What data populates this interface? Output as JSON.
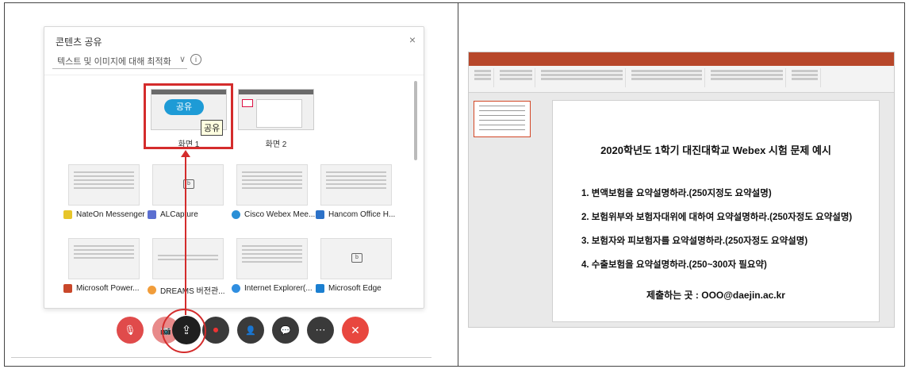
{
  "share_dialog": {
    "title": "콘텐츠 공유",
    "close": "×",
    "optimize_option": "텍스트 및 이미지에 대해 최적화",
    "info": "i",
    "screens": [
      {
        "label": "화면 1",
        "share_button": "공유",
        "tooltip": "공유"
      },
      {
        "label": "화면 2"
      }
    ],
    "apps": [
      {
        "label": "NateOn Messenger",
        "icon": "nateon-icon",
        "color": "#e7c52a"
      },
      {
        "label": "ALCapture",
        "icon": "alcapture-icon",
        "color": "#5b6fd1"
      },
      {
        "label": "Cisco Webex Mee...",
        "icon": "webex-icon",
        "color": "#2a8fd6"
      },
      {
        "label": "Hancom Office H...",
        "icon": "hancom-icon",
        "color": "#2d72c8"
      },
      {
        "label": "Microsoft Power...",
        "icon": "powerpoint-icon",
        "color": "#c9472a"
      },
      {
        "label": "DREAMS 버전관...",
        "icon": "dreams-icon",
        "color": "#f19d3b"
      },
      {
        "label": "Internet Explorer(...",
        "icon": "ie-icon",
        "color": "#2f8ee0"
      },
      {
        "label": "Microsoft Edge",
        "icon": "edge-icon",
        "color": "#1b7fd0"
      }
    ]
  },
  "toolbar": [
    {
      "name": "mute-button",
      "icon": "mic-off-icon",
      "color": "#e04b4b",
      "glyph": "🎙"
    },
    {
      "name": "video-button",
      "icon": "camera-off-icon",
      "color": "#e88a8a",
      "glyph": "📷"
    },
    {
      "name": "share-content-button",
      "icon": "share-icon",
      "color": "#1f1f1f",
      "glyph": "⇪"
    },
    {
      "name": "record-button",
      "icon": "record-icon",
      "color": "#3a3a3a",
      "glyph": "⏺"
    },
    {
      "name": "participants-button",
      "icon": "participants-icon",
      "color": "#3a3a3a",
      "glyph": "👤"
    },
    {
      "name": "chat-button",
      "icon": "chat-icon",
      "color": "#3a3a3a",
      "glyph": "💬"
    },
    {
      "name": "more-button",
      "icon": "more-icon",
      "color": "#3a3a3a",
      "glyph": "⋯"
    },
    {
      "name": "leave-button",
      "icon": "close-icon",
      "color": "#e8473f",
      "glyph": "✕"
    }
  ],
  "slide": {
    "title": "2020학년도 1학기 대진대학교 Webex 시험 문제 예시",
    "questions": [
      "1. 변액보험을 요약설명하라.(250지정도 요약설명)",
      "2. 보험위부와 보험자대위에 대하여 요약설명하라.(250자정도 요약설명)",
      "3. 보험자와 피보험자를 요약설명하라.(250자정도 요약설명)",
      "4. 수출보험을 요약설명하라.(250~300자 필요약)"
    ],
    "submit": "제출하는 곳 : OOO@daejin.ac.kr"
  }
}
